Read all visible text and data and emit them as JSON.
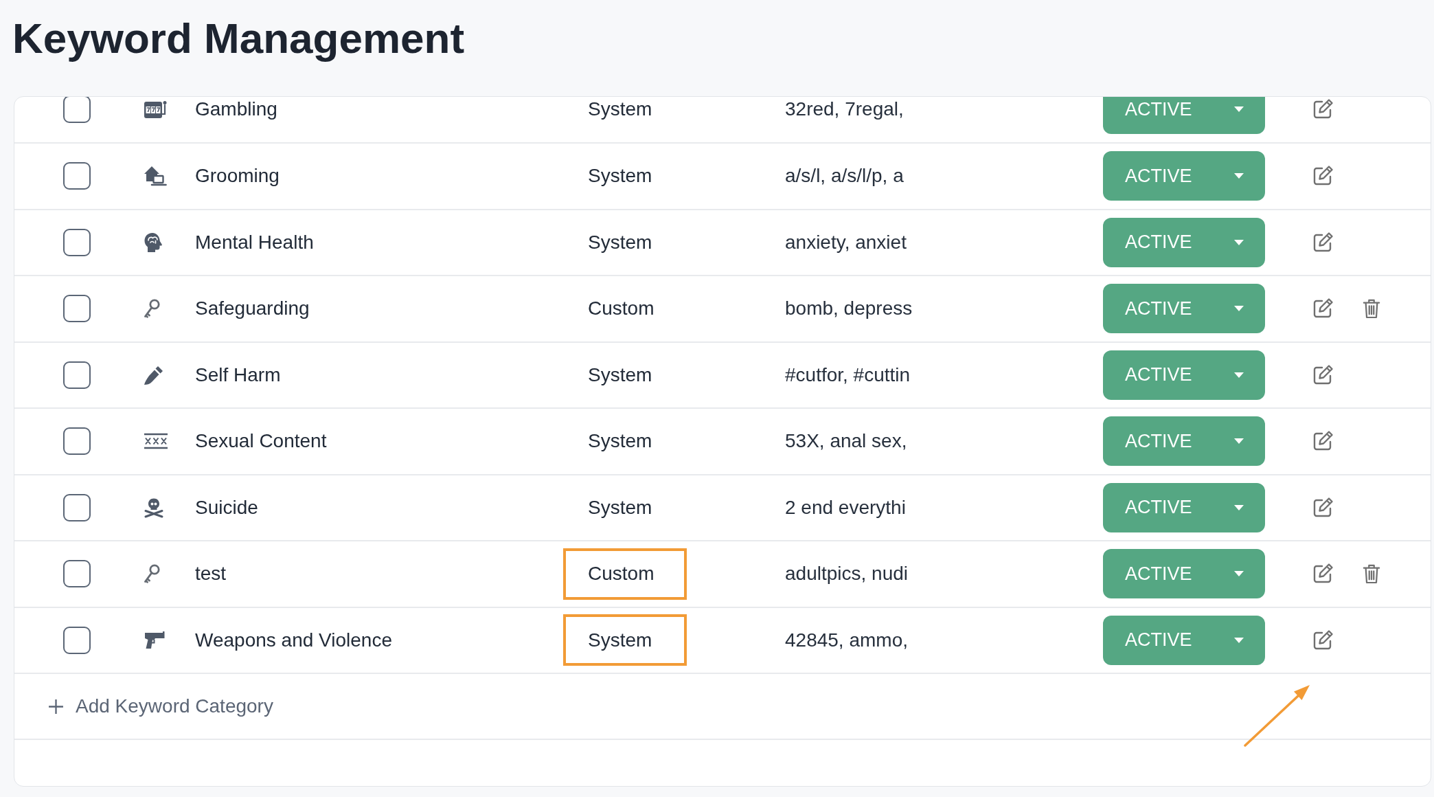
{
  "page": {
    "title": "Keyword Management"
  },
  "rows": [
    {
      "kind": "slots",
      "checked": false,
      "name": "Gambling",
      "type": "System",
      "keywords": "32red, 7regal,",
      "status": "ACTIVE",
      "deletable": false,
      "highlighted": false,
      "pointed": false
    },
    {
      "kind": "home",
      "checked": false,
      "name": "Grooming",
      "type": "System",
      "keywords": "a/s/l, a/s/l/p, a",
      "status": "ACTIVE",
      "deletable": false,
      "highlighted": false,
      "pointed": false
    },
    {
      "kind": "brain",
      "checked": false,
      "name": "Mental Health",
      "type": "System",
      "keywords": "anxiety, anxiet",
      "status": "ACTIVE",
      "deletable": false,
      "highlighted": false,
      "pointed": false
    },
    {
      "kind": "key",
      "checked": false,
      "name": "Safeguarding",
      "type": "Custom",
      "keywords": "bomb, depress",
      "status": "ACTIVE",
      "deletable": true,
      "highlighted": false,
      "pointed": false
    },
    {
      "kind": "knife",
      "checked": false,
      "name": "Self Harm",
      "type": "System",
      "keywords": "#cutfor, #cuttin",
      "status": "ACTIVE",
      "deletable": false,
      "highlighted": false,
      "pointed": false
    },
    {
      "kind": "xxx",
      "checked": false,
      "name": "Sexual Content",
      "type": "System",
      "keywords": "53X, anal sex,",
      "status": "ACTIVE",
      "deletable": false,
      "highlighted": false,
      "pointed": false
    },
    {
      "kind": "skull",
      "checked": false,
      "name": "Suicide",
      "type": "System",
      "keywords": "2 end everythi",
      "status": "ACTIVE",
      "deletable": false,
      "highlighted": false,
      "pointed": false
    },
    {
      "kind": "key",
      "checked": false,
      "name": "test",
      "type": "Custom",
      "keywords": "adultpics, nudi",
      "status": "ACTIVE",
      "deletable": true,
      "highlighted": true,
      "pointed": false
    },
    {
      "kind": "gun",
      "checked": false,
      "name": "Weapons and Violence",
      "type": "System",
      "keywords": "42845, ammo,",
      "status": "ACTIVE",
      "deletable": false,
      "highlighted": true,
      "pointed": true
    }
  ],
  "add_button": {
    "label": "Add Keyword Category"
  }
}
